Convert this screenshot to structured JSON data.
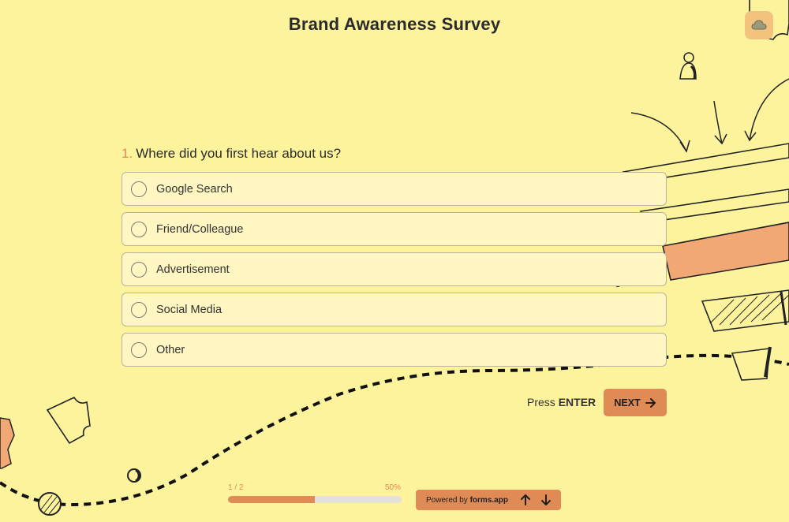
{
  "survey": {
    "title": "Brand Awareness Survey"
  },
  "question": {
    "number": "1.",
    "text": "Where did you first hear about us?",
    "options": [
      {
        "label": "Google Search"
      },
      {
        "label": "Friend/Colleague"
      },
      {
        "label": "Advertisement"
      },
      {
        "label": "Social Media"
      },
      {
        "label": "Other"
      }
    ]
  },
  "actions": {
    "press_prefix": "Press",
    "press_key": "ENTER",
    "next_label": "NEXT",
    "next_icon": "arrow-right-icon"
  },
  "progress": {
    "step_label": "1 / 2",
    "percent_label": "50%",
    "percent": 50
  },
  "footer": {
    "powered_prefix": "Powered by",
    "powered_brand": "forms.app",
    "up_icon": "arrow-up-icon",
    "down_icon": "arrow-down-icon"
  },
  "colors": {
    "background": "#fdf39d",
    "accent": "#e08a55",
    "option_bg": "#fff6c2"
  }
}
